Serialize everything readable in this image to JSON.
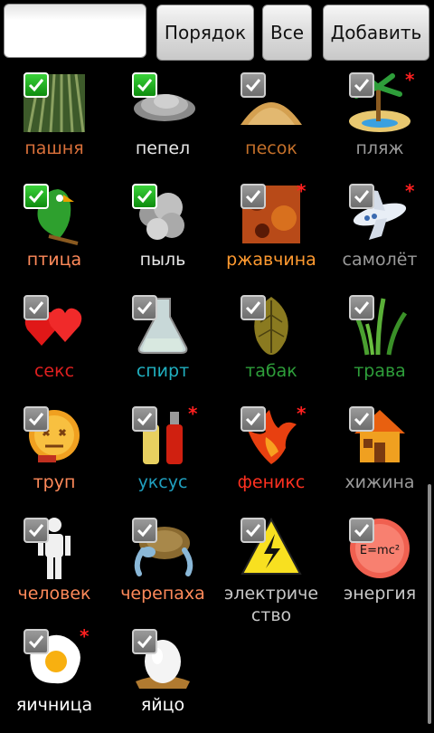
{
  "toolbar": {
    "order_label": "Порядок",
    "all_label": "Все",
    "add_label": "Добавить",
    "search_value": ""
  },
  "elements": [
    {
      "label": "пашня",
      "color": "#d9703a",
      "checked": true,
      "starred": false,
      "icon": "field-icon"
    },
    {
      "label": "пепел",
      "color": "#e8e8e8",
      "checked": true,
      "starred": false,
      "icon": "ash-icon"
    },
    {
      "label": "песок",
      "color": "#c4702a",
      "checked": false,
      "starred": false,
      "icon": "sand-icon"
    },
    {
      "label": "пляж",
      "color": "#9a9a9a",
      "checked": false,
      "starred": true,
      "icon": "beach-icon"
    },
    {
      "label": "птица",
      "color": "#ff8a5a",
      "checked": true,
      "starred": false,
      "icon": "bird-icon"
    },
    {
      "label": "пыль",
      "color": "#e8e8e8",
      "checked": true,
      "starred": false,
      "icon": "dust-icon"
    },
    {
      "label": "ржавчина",
      "color": "#ff9a30",
      "checked": false,
      "starred": true,
      "icon": "rust-icon"
    },
    {
      "label": "самолёт",
      "color": "#9a9a9a",
      "checked": false,
      "starred": true,
      "icon": "airplane-icon"
    },
    {
      "label": "секс",
      "color": "#e02020",
      "checked": false,
      "starred": false,
      "icon": "hearts-icon"
    },
    {
      "label": "спирт",
      "color": "#20b0c0",
      "checked": false,
      "starred": false,
      "icon": "flask-icon"
    },
    {
      "label": "табак",
      "color": "#2e9e3a",
      "checked": false,
      "starred": false,
      "icon": "tobacco-leaf-icon"
    },
    {
      "label": "трава",
      "color": "#2e9e3a",
      "checked": false,
      "starred": false,
      "icon": "grass-icon"
    },
    {
      "label": "труп",
      "color": "#ff8a5a",
      "checked": false,
      "starred": false,
      "icon": "corpse-icon"
    },
    {
      "label": "уксус",
      "color": "#20a0c0",
      "checked": false,
      "starred": true,
      "icon": "vinegar-icon"
    },
    {
      "label": "феникс",
      "color": "#ff3020",
      "checked": false,
      "starred": true,
      "icon": "phoenix-icon"
    },
    {
      "label": "хижина",
      "color": "#9a9a9a",
      "checked": false,
      "starred": false,
      "icon": "hut-icon"
    },
    {
      "label": "человек",
      "color": "#ff8a5a",
      "checked": false,
      "starred": false,
      "icon": "human-icon"
    },
    {
      "label": "черепаха",
      "color": "#ff8a5a",
      "checked": false,
      "starred": false,
      "icon": "turtle-icon"
    },
    {
      "label": "электриче\nство",
      "color": "#c8c8c8",
      "checked": false,
      "starred": false,
      "icon": "electricity-icon"
    },
    {
      "label": "энергия",
      "color": "#c8c8c8",
      "checked": false,
      "starred": false,
      "icon": "energy-icon"
    },
    {
      "label": "яичница",
      "color": "#ffffff",
      "checked": false,
      "starred": true,
      "icon": "fried-egg-icon"
    },
    {
      "label": "яйцо",
      "color": "#ffffff",
      "checked": false,
      "starred": false,
      "icon": "egg-icon"
    }
  ]
}
